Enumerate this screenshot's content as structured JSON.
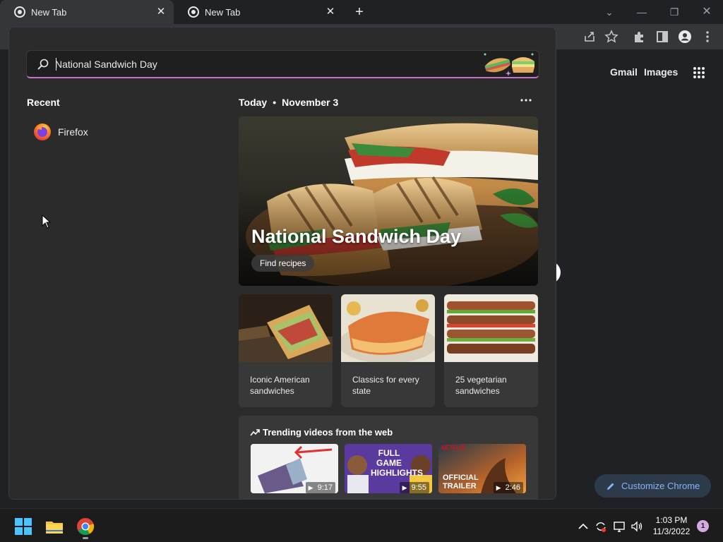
{
  "tabs": [
    {
      "title": "New Tab",
      "active": true
    },
    {
      "title": "New Tab",
      "active": false
    }
  ],
  "page": {
    "gmail_link": "Gmail",
    "images_link": "Images",
    "customize_label": "Customize Chrome"
  },
  "widgets": {
    "search": {
      "value": "National Sandwich Day"
    },
    "recent": {
      "title": "Recent",
      "items": [
        {
          "label": "Firefox",
          "icon": "firefox-icon"
        }
      ]
    },
    "today": {
      "label": "Today",
      "date": "November 3"
    },
    "hero": {
      "title": "National Sandwich Day",
      "button": "Find recipes"
    },
    "cards": [
      {
        "text": "Iconic American sandwiches"
      },
      {
        "text": "Classics for every state"
      },
      {
        "text": "25 vegetarian sandwiches"
      }
    ],
    "trending": {
      "title": "Trending videos from the web",
      "videos": [
        {
          "duration": "9:17"
        },
        {
          "duration": "9:55",
          "overlay": "FULL GAME HIGHLIGHTS"
        },
        {
          "duration": "2:46",
          "overlay": "OFFICIAL TRAILER",
          "brand": "NETFLIX"
        }
      ]
    }
  },
  "taskbar": {
    "time": "1:03 PM",
    "date": "11/3/2022",
    "notification_count": "1"
  },
  "colors": {
    "accent_blue": "#8ab4f8",
    "search_underline": "#c873c8",
    "panel_bg": "#2b2b2b"
  }
}
